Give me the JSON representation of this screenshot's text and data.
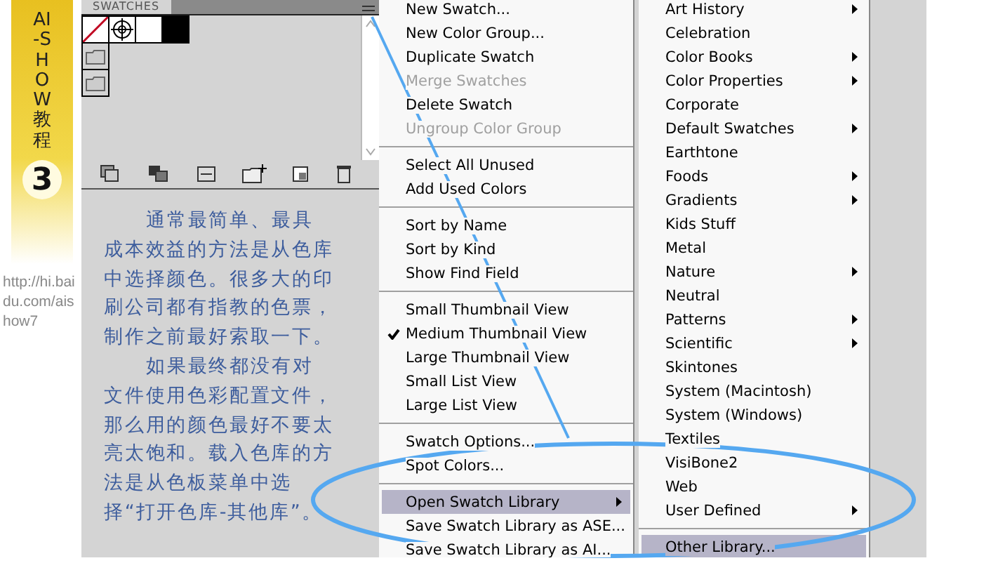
{
  "ribbon": {
    "title": "AI-SHOW教程",
    "number": "3"
  },
  "url": "http://hi.baidu.com/aishow7",
  "panel": {
    "tab": "SWATCHES",
    "swatches": [
      {
        "kind": "none"
      },
      {
        "kind": "registration"
      },
      {
        "kind": "color",
        "color": "#ffffff"
      },
      {
        "kind": "color",
        "color": "#000000"
      }
    ],
    "groups": [
      {
        "kind": "folder"
      },
      {
        "kind": "folder"
      }
    ],
    "paragraphs": [
      "通常最简单、最具成本效益的方法是从色库中选择颜色。很多大的印刷公司都有指教的色票，制作之前最好索取一下。",
      "如果最终都没有对文件使用色彩配置文件，那么用的颜色最好不要太亮太饱和。载入色库的方法是从色板菜单中选择“打开色库-其他库”。"
    ]
  },
  "panel_menu": {
    "items": [
      {
        "kind": "item",
        "label": "New Swatch...",
        "disabled": false,
        "checked": false,
        "selected": false,
        "submenu": false
      },
      {
        "kind": "item",
        "label": "New Color Group...",
        "disabled": false,
        "checked": false,
        "selected": false,
        "submenu": false
      },
      {
        "kind": "item",
        "label": "Duplicate Swatch",
        "disabled": false,
        "checked": false,
        "selected": false,
        "submenu": false
      },
      {
        "kind": "item",
        "label": "Merge Swatches",
        "disabled": true,
        "checked": false,
        "selected": false,
        "submenu": false
      },
      {
        "kind": "item",
        "label": "Delete Swatch",
        "disabled": false,
        "checked": false,
        "selected": false,
        "submenu": false
      },
      {
        "kind": "item",
        "label": "Ungroup Color Group",
        "disabled": true,
        "checked": false,
        "selected": false,
        "submenu": false
      },
      {
        "kind": "separator"
      },
      {
        "kind": "item",
        "label": "Select All Unused",
        "disabled": false,
        "checked": false,
        "selected": false,
        "submenu": false
      },
      {
        "kind": "item",
        "label": "Add Used Colors",
        "disabled": false,
        "checked": false,
        "selected": false,
        "submenu": false
      },
      {
        "kind": "separator"
      },
      {
        "kind": "item",
        "label": "Sort by Name",
        "disabled": false,
        "checked": false,
        "selected": false,
        "submenu": false
      },
      {
        "kind": "item",
        "label": "Sort by Kind",
        "disabled": false,
        "checked": false,
        "selected": false,
        "submenu": false
      },
      {
        "kind": "item",
        "label": "Show Find Field",
        "disabled": false,
        "checked": false,
        "selected": false,
        "submenu": false
      },
      {
        "kind": "separator"
      },
      {
        "kind": "item",
        "label": "Small Thumbnail View",
        "disabled": false,
        "checked": false,
        "selected": false,
        "submenu": false
      },
      {
        "kind": "item",
        "label": "Medium Thumbnail View",
        "disabled": false,
        "checked": true,
        "selected": false,
        "submenu": false
      },
      {
        "kind": "item",
        "label": "Large Thumbnail View",
        "disabled": false,
        "checked": false,
        "selected": false,
        "submenu": false
      },
      {
        "kind": "item",
        "label": "Small List View",
        "disabled": false,
        "checked": false,
        "selected": false,
        "submenu": false
      },
      {
        "kind": "item",
        "label": "Large List View",
        "disabled": false,
        "checked": false,
        "selected": false,
        "submenu": false
      },
      {
        "kind": "separator"
      },
      {
        "kind": "item",
        "label": "Swatch Options...",
        "disabled": false,
        "checked": false,
        "selected": false,
        "submenu": false
      },
      {
        "kind": "item",
        "label": "Spot Colors...",
        "disabled": false,
        "checked": false,
        "selected": false,
        "submenu": false
      },
      {
        "kind": "separator"
      },
      {
        "kind": "item",
        "label": "Open Swatch Library",
        "disabled": false,
        "checked": false,
        "selected": true,
        "submenu": true
      },
      {
        "kind": "item",
        "label": "Save Swatch Library as ASE...",
        "disabled": false,
        "checked": false,
        "selected": false,
        "submenu": false
      },
      {
        "kind": "item",
        "label": "Save Swatch Library as AI...",
        "disabled": false,
        "checked": false,
        "selected": false,
        "submenu": false
      }
    ]
  },
  "library_menu": {
    "items": [
      {
        "kind": "item",
        "label": "Art History",
        "disabled": false,
        "checked": false,
        "selected": false,
        "submenu": true
      },
      {
        "kind": "item",
        "label": "Celebration",
        "disabled": false,
        "checked": false,
        "selected": false,
        "submenu": false
      },
      {
        "kind": "item",
        "label": "Color Books",
        "disabled": false,
        "checked": false,
        "selected": false,
        "submenu": true
      },
      {
        "kind": "item",
        "label": "Color Properties",
        "disabled": false,
        "checked": false,
        "selected": false,
        "submenu": true
      },
      {
        "kind": "item",
        "label": "Corporate",
        "disabled": false,
        "checked": false,
        "selected": false,
        "submenu": false
      },
      {
        "kind": "item",
        "label": "Default Swatches",
        "disabled": false,
        "checked": false,
        "selected": false,
        "submenu": true
      },
      {
        "kind": "item",
        "label": "Earthtone",
        "disabled": false,
        "checked": false,
        "selected": false,
        "submenu": false
      },
      {
        "kind": "item",
        "label": "Foods",
        "disabled": false,
        "checked": false,
        "selected": false,
        "submenu": true
      },
      {
        "kind": "item",
        "label": "Gradients",
        "disabled": false,
        "checked": false,
        "selected": false,
        "submenu": true
      },
      {
        "kind": "item",
        "label": "Kids Stuff",
        "disabled": false,
        "checked": false,
        "selected": false,
        "submenu": false
      },
      {
        "kind": "item",
        "label": "Metal",
        "disabled": false,
        "checked": false,
        "selected": false,
        "submenu": false
      },
      {
        "kind": "item",
        "label": "Nature",
        "disabled": false,
        "checked": false,
        "selected": false,
        "submenu": true
      },
      {
        "kind": "item",
        "label": "Neutral",
        "disabled": false,
        "checked": false,
        "selected": false,
        "submenu": false
      },
      {
        "kind": "item",
        "label": "Patterns",
        "disabled": false,
        "checked": false,
        "selected": false,
        "submenu": true
      },
      {
        "kind": "item",
        "label": "Scientific",
        "disabled": false,
        "checked": false,
        "selected": false,
        "submenu": true
      },
      {
        "kind": "item",
        "label": "Skintones",
        "disabled": false,
        "checked": false,
        "selected": false,
        "submenu": false
      },
      {
        "kind": "item",
        "label": "System (Macintosh)",
        "disabled": false,
        "checked": false,
        "selected": false,
        "submenu": false
      },
      {
        "kind": "item",
        "label": "System (Windows)",
        "disabled": false,
        "checked": false,
        "selected": false,
        "submenu": false
      },
      {
        "kind": "item",
        "label": "Textiles",
        "disabled": false,
        "checked": false,
        "selected": false,
        "submenu": false
      },
      {
        "kind": "item",
        "label": "VisiBone2",
        "disabled": false,
        "checked": false,
        "selected": false,
        "submenu": false
      },
      {
        "kind": "item",
        "label": "Web",
        "disabled": false,
        "checked": false,
        "selected": false,
        "submenu": false
      },
      {
        "kind": "item",
        "label": "User Defined",
        "disabled": false,
        "checked": false,
        "selected": false,
        "submenu": true
      },
      {
        "kind": "separator"
      },
      {
        "kind": "item",
        "label": "Other Library...",
        "disabled": false,
        "checked": false,
        "selected": true,
        "submenu": false
      }
    ]
  }
}
